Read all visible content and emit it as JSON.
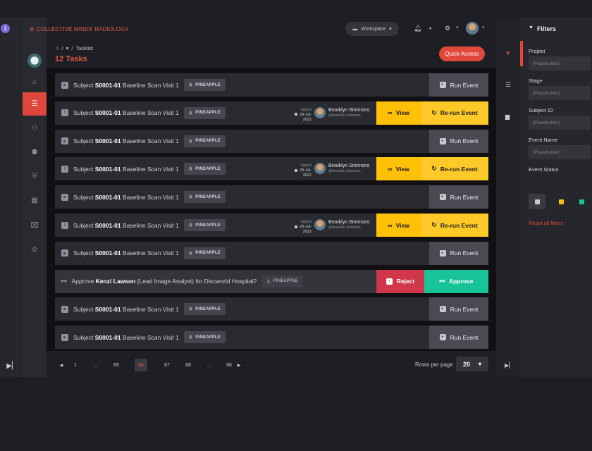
{
  "badge": "1",
  "brand": {
    "name": "COLLECTIVE MINDS",
    "suffix": "RADIOLOGY"
  },
  "header": {
    "workspace": "Workspace"
  },
  "breadcrumb": {
    "home": "⌂",
    "sep": "/",
    "current": "Tasklist"
  },
  "page_title": "12 Tasks",
  "quick_access": "Quick Access",
  "subject_prefix": "Subject",
  "subject_id": "S0001-01",
  "subject_suffix": "Baseline Scan Visit 1",
  "tag_label": "PINEAPPLE",
  "run_label": "Run Event",
  "view_label": "View",
  "rerun_label": "Re-run Event",
  "signed_label": "Signed",
  "signed_date": "29-Jul-2022",
  "person_name": "Brooklyn Simmons",
  "person_handle": "@brooklyn-simmons",
  "approval": {
    "prefix": "Approve",
    "name": "Kenzi Lawson",
    "suffix": "(Lead Image Analyst) for Discworld Hospital?",
    "tag": "PINEAPPLE",
    "reject": "Reject",
    "approve": "Approve"
  },
  "pagination": {
    "pages": [
      "1",
      "...",
      "65",
      "66",
      "67",
      "68",
      "...",
      "88"
    ],
    "current": "66",
    "rows_label": "Rows per page",
    "rows_value": "20"
  },
  "filters": {
    "title": "Filters",
    "project_label": "Project",
    "project_placeholder": "(Placeholder)",
    "stage_label": "Stage",
    "stage_placeholder": "(Placeholder)",
    "subject_label": "Subject ID",
    "subject_placeholder": "(Placeholder)",
    "event_label": "Event Name",
    "event_placeholder": "(Placeholder)",
    "status_label": "Event Status",
    "reset": "Reset all filters"
  },
  "colors": {
    "accent": "#e2473c",
    "view": "#ffc107",
    "approve": "#19c398",
    "reject": "#d0374a"
  }
}
